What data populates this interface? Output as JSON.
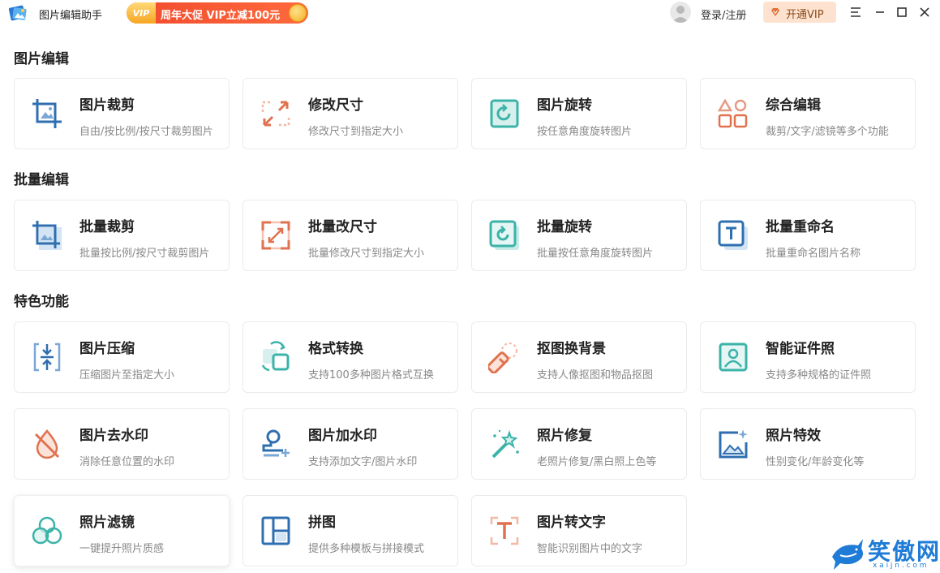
{
  "titlebar": {
    "app_title": "图片编辑助手",
    "promo_badge": "VIP",
    "promo_text": "周年大促 VIP立减100元",
    "login": "登录/注册",
    "vip_button": "开通VIP"
  },
  "sections": [
    {
      "title": "图片编辑"
    },
    {
      "title": "批量编辑"
    },
    {
      "title": "特色功能"
    }
  ],
  "cards": [
    {
      "title": "图片裁剪",
      "desc": "自由/按比例/按尺寸裁剪图片",
      "icon": "crop-icon"
    },
    {
      "title": "修改尺寸",
      "desc": "修改尺寸到指定大小",
      "icon": "resize-icon"
    },
    {
      "title": "图片旋转",
      "desc": "按任意角度旋转图片",
      "icon": "rotate-icon"
    },
    {
      "title": "综合编辑",
      "desc": "裁剪/文字/滤镜等多个功能",
      "icon": "shapes-icon"
    },
    {
      "title": "批量裁剪",
      "desc": "批量按比例/按尺寸裁剪图片",
      "icon": "batch-crop-icon"
    },
    {
      "title": "批量改尺寸",
      "desc": "批量修改尺寸到指定大小",
      "icon": "batch-resize-icon"
    },
    {
      "title": "批量旋转",
      "desc": "批量按任意角度旋转图片",
      "icon": "batch-rotate-icon"
    },
    {
      "title": "批量重命名",
      "desc": "批量重命名图片名称",
      "icon": "rename-icon"
    },
    {
      "title": "图片压缩",
      "desc": "压缩图片至指定大小",
      "icon": "compress-icon"
    },
    {
      "title": "格式转换",
      "desc": "支持100多种图片格式互换",
      "icon": "convert-icon"
    },
    {
      "title": "抠图换背景",
      "desc": "支持人像抠图和物品抠图",
      "icon": "eraser-icon"
    },
    {
      "title": "智能证件照",
      "desc": "支持多种规格的证件照",
      "icon": "id-photo-icon"
    },
    {
      "title": "图片去水印",
      "desc": "消除任意位置的水印",
      "icon": "remove-watermark-icon"
    },
    {
      "title": "图片加水印",
      "desc": "支持添加文字/图片水印",
      "icon": "add-watermark-icon"
    },
    {
      "title": "照片修复",
      "desc": "老照片修复/黑白照上色等",
      "icon": "magic-wand-icon"
    },
    {
      "title": "照片特效",
      "desc": "性别变化/年龄变化等",
      "icon": "image-sparkle-icon"
    },
    {
      "title": "照片滤镜",
      "desc": "一键提升照片质感",
      "icon": "filter-icon"
    },
    {
      "title": "拼图",
      "desc": "提供多种模板与拼接模式",
      "icon": "collage-icon"
    },
    {
      "title": "图片转文字",
      "desc": "智能识别图片中的文字",
      "icon": "ocr-icon"
    }
  ],
  "watermark": {
    "text": "笑傲网",
    "sub": "x a i j n . c o m"
  },
  "colors": {
    "blue": "#2f6fb0",
    "orange": "#e0724f",
    "teal": "#3bb3a8",
    "promo": "#f04b2d",
    "vip_bg": "#fde2cf"
  }
}
